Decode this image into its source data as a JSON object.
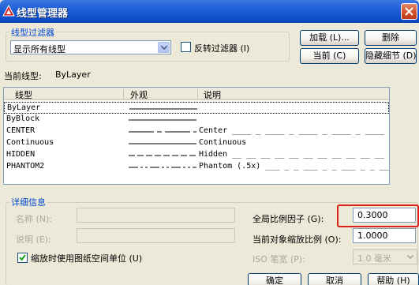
{
  "window": {
    "title": "线型管理器"
  },
  "filter": {
    "group_label": "线型过滤器",
    "selected": "显示所有线型",
    "invert_label": "反转过滤器 (I)",
    "invert_checked": false
  },
  "buttons": {
    "load": "加载 (L)...",
    "delete": "删除",
    "current": "当前 (C)",
    "hide_details": "隐藏细节 (D)",
    "ok": "确定",
    "cancel": "取消",
    "help": "帮助 (H)"
  },
  "current_linetype": {
    "label": "当前线型:",
    "value": "ByLayer"
  },
  "table": {
    "columns": [
      "线型",
      "外观",
      "说明"
    ],
    "rows": [
      {
        "name": "ByLayer",
        "description": ""
      },
      {
        "name": "ByBlock",
        "description": ""
      },
      {
        "name": "CENTER",
        "description": "Center ____ _ ____ _ ____ _ ____ _ ____ _ ____"
      },
      {
        "name": "Continuous",
        "description": "Continuous"
      },
      {
        "name": "HIDDEN",
        "description": "Hidden __ __ __ __ __ __ __ __ __ __ __ __ __ __"
      },
      {
        "name": "PHANTOM2",
        "description": "Phantom (.5x) ___ _ _ ___ _ _ ___ _ _ ___ _ _"
      }
    ]
  },
  "details": {
    "group_label": "详细信息",
    "name_label": "名称 (N):",
    "name_value": "",
    "desc_label": "说明 (E):",
    "desc_value": "",
    "paper_space_label": "缩放时使用图纸空间单位 (U)",
    "paper_space_checked": true,
    "global_scale_label": "全局比例因子 (G):",
    "global_scale_value": "0.3000",
    "current_scale_label": "当前对象缩放比例 (O):",
    "current_scale_value": "1.0000",
    "iso_pen_label": "ISO 笔宽 (P):",
    "iso_pen_value": "1.0 毫米"
  },
  "colors": {
    "title_bar": "#0b4dc5",
    "highlight_box": "#d9221a",
    "group_label": "#0046d5"
  }
}
